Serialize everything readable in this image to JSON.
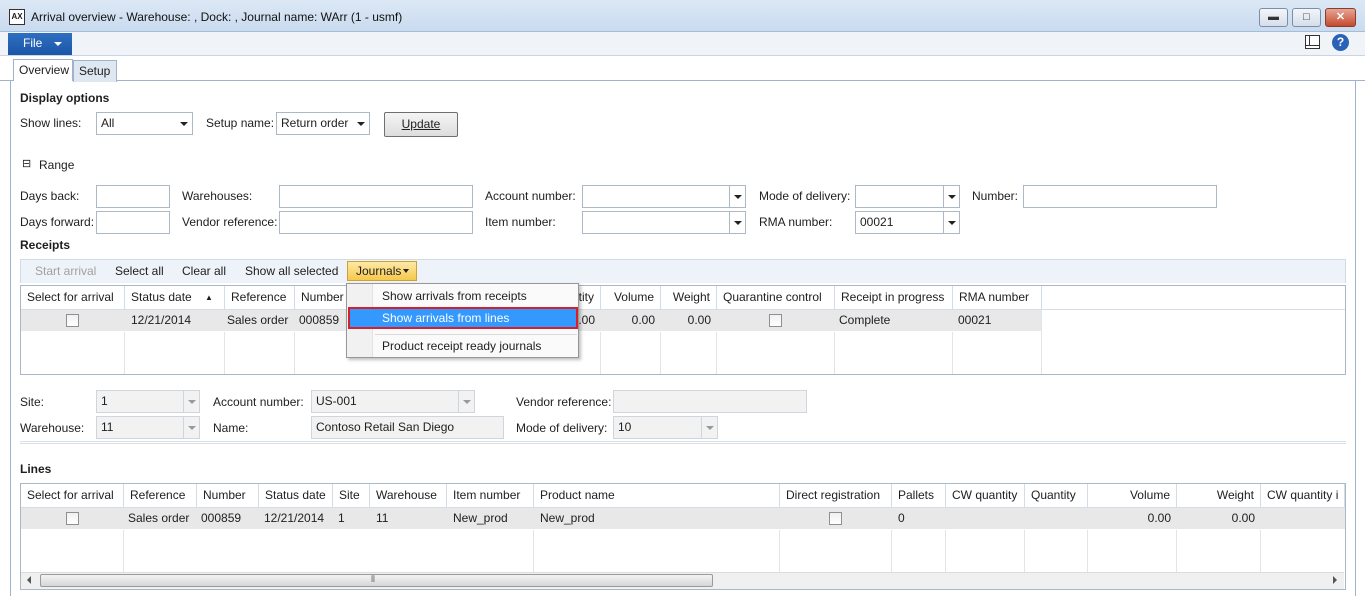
{
  "window": {
    "title": "Arrival overview - Warehouse: , Dock: , Journal name: WArr (1 - usmf)",
    "app_icon_text": "AX",
    "min_icon": "minimize-icon",
    "max_icon": "maximize-icon",
    "close_icon": "close-icon",
    "min_glyph": "▬",
    "max_glyph": "□",
    "close_glyph": "✕"
  },
  "ribbon": {
    "file_label": "File",
    "layout_icon": "layout-icon",
    "help_icon": "help-icon",
    "help_glyph": "?"
  },
  "tabs": [
    {
      "label": "Overview",
      "active": true
    },
    {
      "label": "Setup",
      "active": false
    }
  ],
  "display_options": {
    "heading": "Display options",
    "show_lines_label": "Show lines:",
    "show_lines_value": "All",
    "setup_name_label": "Setup name:",
    "setup_name_value": "Return order",
    "update_label": "Update"
  },
  "range": {
    "toggle_glyph": "⊟",
    "heading": "Range",
    "days_back_label": "Days back:",
    "days_back_value": "",
    "days_forward_label": "Days forward:",
    "days_forward_value": "",
    "warehouses_label": "Warehouses:",
    "warehouses_value": "",
    "vendor_reference_label": "Vendor reference:",
    "vendor_reference_value": "",
    "account_number_label": "Account number:",
    "account_number_value": "",
    "item_number_label": "Item number:",
    "item_number_value": "",
    "mode_of_delivery_label": "Mode of delivery:",
    "mode_of_delivery_value": "",
    "rma_number_label": "RMA number:",
    "rma_number_value": "00021",
    "number_label": "Number:",
    "number_value": ""
  },
  "receipts": {
    "heading": "Receipts",
    "toolbar": {
      "start_arrival": "Start arrival",
      "select_all": "Select all",
      "clear_all": "Clear all",
      "show_all_selected": "Show all selected",
      "journals": "Journals"
    },
    "columns": [
      "Select for arrival",
      "Status date",
      "Reference",
      "Number",
      "",
      "",
      "",
      "tity",
      "Volume",
      "Weight",
      "Quarantine control",
      "Receipt in progress",
      "RMA number"
    ],
    "sort_glyph": "▲",
    "rows": [
      {
        "select": false,
        "status_date": "12/21/2014",
        "reference": "Sales order",
        "number": "000859",
        "quantity": ".00",
        "volume": "0.00",
        "weight": "0.00",
        "quarantine": false,
        "receipt_in_progress": "Complete",
        "rma_number": "00021"
      }
    ]
  },
  "journals_menu": {
    "items": [
      "Show arrivals from receipts",
      "Show arrivals from lines",
      "Product receipt ready journals"
    ],
    "selected_index": 1
  },
  "details": {
    "site_label": "Site:",
    "site_value": "1",
    "warehouse_label": "Warehouse:",
    "warehouse_value": "11",
    "account_number_label": "Account number:",
    "account_number_value": "US-001",
    "name_label": "Name:",
    "name_value": "Contoso Retail San Diego",
    "vendor_reference_label": "Vendor reference:",
    "vendor_reference_value": "",
    "mode_of_delivery_label": "Mode of delivery:",
    "mode_of_delivery_value": "10"
  },
  "lines": {
    "heading": "Lines",
    "columns": [
      "Select for arrival",
      "Reference",
      "Number",
      "Status date",
      "Site",
      "Warehouse",
      "Item number",
      "Product name",
      "Direct registration",
      "Pallets",
      "CW quantity",
      "Quantity",
      "Volume",
      "Weight",
      "CW quantity i"
    ],
    "rows": [
      {
        "select": false,
        "reference": "Sales order",
        "number": "000859",
        "status_date": "12/21/2014",
        "site": "1",
        "warehouse": "11",
        "item_number": "New_prod",
        "product_name": "New_prod",
        "direct_registration": false,
        "pallets": "0",
        "cw_quantity": "",
        "quantity": "",
        "volume": "0.00",
        "weight": "0.00",
        "cw_quantity_i": ""
      }
    ],
    "scroll_grip": "⦀"
  },
  "colors": {
    "accent": "#1b56a8",
    "menu_highlight": "#3399ff",
    "highlight_border": "#d81e2a",
    "journals_button": "#f7c84b"
  }
}
